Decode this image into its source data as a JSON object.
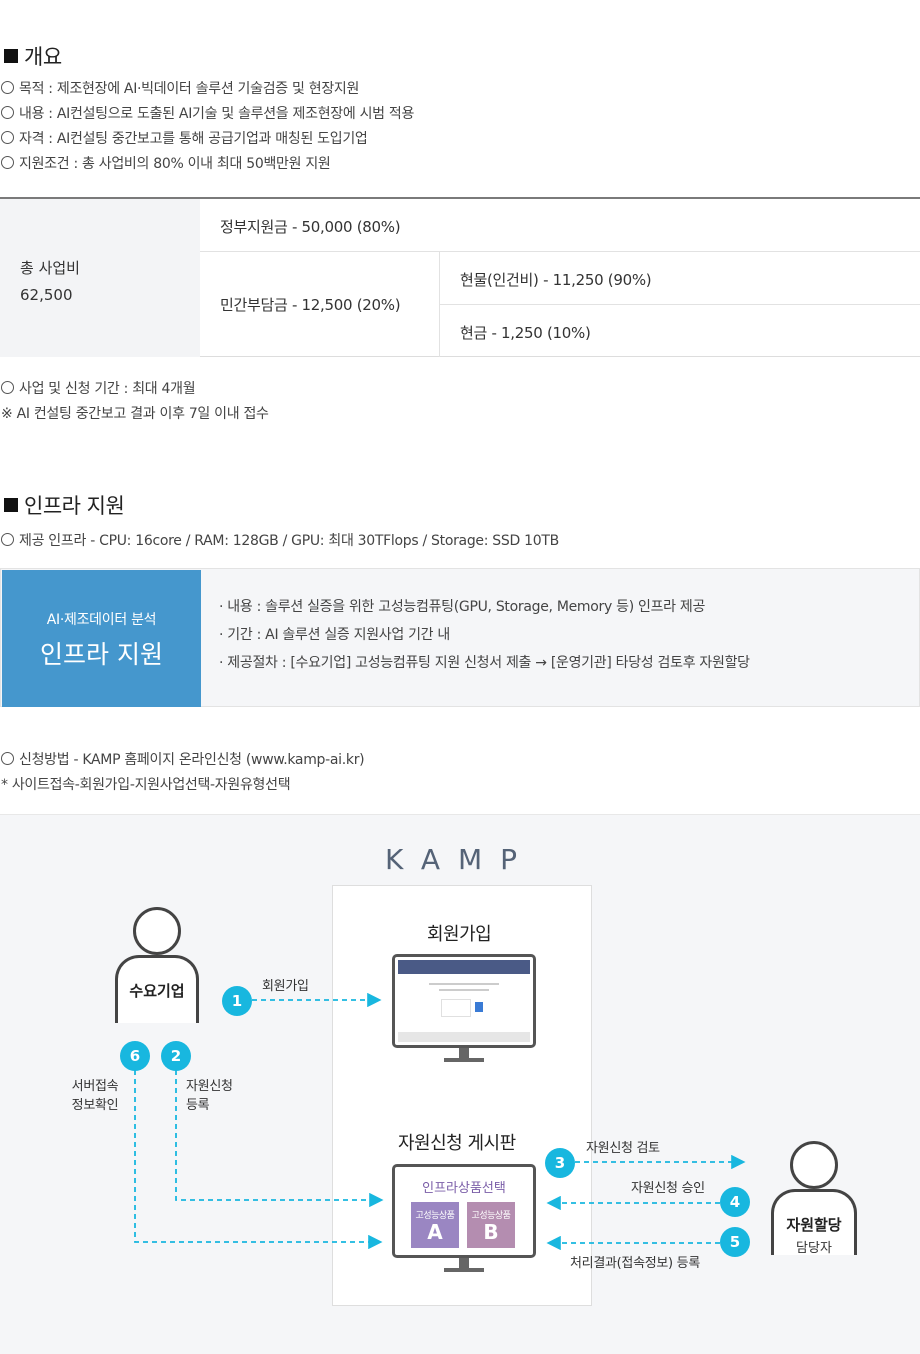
{
  "overview": {
    "title": "개요",
    "items": [
      "목적 : 제조현장에 AI·빅데이터 솔루션 기술검증 및 현장지원",
      "내용 : AI컨설팅으로 도출된 AI기술 및 솔루션을 제조현장에 시범 적용",
      "자격 : AI컨설팅 중간보고를 통해 공급기업과 매칭된 도입기업",
      "지원조건 : 총 사업비의 80% 이내 최대 50백만원 지원"
    ]
  },
  "budget": {
    "total_label": "총 사업비",
    "total_value": "62,500",
    "gov": "정부지원금 - 50,000 (80%)",
    "private": "민간부담금 - 12,500 (20%)",
    "in_kind": "현물(인건비) - 11,250 (90%)",
    "cash": "현금 - 1,250 (10%)"
  },
  "period": {
    "line1": "사업 및 신청 기간 : 최대 4개월",
    "line2": "※ AI 컨설팅 중간보고 결과 이후 7일 이내 접수"
  },
  "infra": {
    "title": "인프라 지원",
    "spec": "제공 인프라 - CPU: 16core / RAM: 128GB / GPU: 최대 30TFlops / Storage: SSD 10TB",
    "box_small": "AI·제조데이터 분석",
    "box_big": "인프라 지원",
    "details": [
      "· 내용 : 솔루션 실증을 위한 고성능컴퓨팅(GPU, Storage, Memory 등) 인프라 제공",
      "· 기간 : AI 솔루션 실증 지원사업 기간 내",
      "· 제공절차 : [수요기업] 고성능컴퓨팅 지원 신청서 제출 → [운영기관] 타당성 검토후 자원할당"
    ]
  },
  "apply": {
    "line1": "신청방법 - KAMP 홈페이지 온라인신청 (www.kamp-ai.kr)",
    "line2": "* 사이트접속-회원가입-지원사업선택-자원유형선택"
  },
  "diagram": {
    "logo": "KAMP",
    "demand_company": "수요기업",
    "signup_title": "회원가입",
    "board_title": "자원신청 게시판",
    "product_select": "인프라상품선택",
    "product_a_label": "고성능상품",
    "product_a": "A",
    "product_b_label": "고성능상품",
    "product_b": "B",
    "manager_line1": "자원할당",
    "manager_line2": "담당자",
    "steps": {
      "s1": "1",
      "s1_label": "회원가입",
      "s2": "2",
      "s2_label_1": "자원신청",
      "s2_label_2": "등록",
      "s3": "3",
      "s3_label": "자원신청 검토",
      "s4": "4",
      "s4_label": "자원신청 승인",
      "s5": "5",
      "s5_label": "처리결과(접속정보) 등록",
      "s6": "6",
      "s6_label_1": "서버접속",
      "s6_label_2": "정보확인"
    },
    "colors": {
      "accent": "#18b7df",
      "product": "#a38fb8",
      "box_blue": "#4597cd"
    }
  }
}
